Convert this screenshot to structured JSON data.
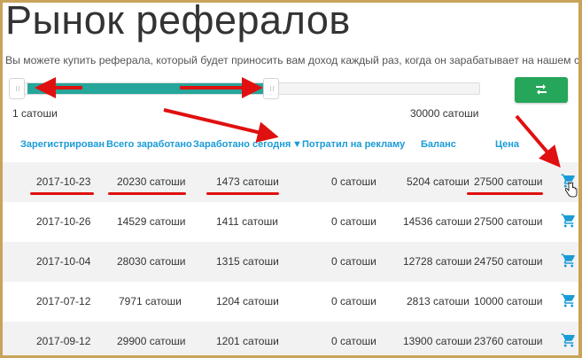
{
  "page": {
    "title": "Рынок рефералов",
    "description": "Вы можете купить реферала, который будет приносить вам доход каждый раз, когда он зарабатывает на нашем сайте."
  },
  "filter": {
    "range_min_label": "1 сатоши",
    "range_max_label": "30000 сатоши",
    "apply_icon": "swap-arrows-icon"
  },
  "table": {
    "headers": {
      "registered": "Зарегистрирован",
      "total_earned": "Всего заработано",
      "earned_today": "Заработано сегодня",
      "sort_indicator": "▼",
      "spent_on_ads": "Потратил на рекламу",
      "balance": "Баланс",
      "price": "Цена"
    },
    "rows": [
      {
        "registered": "2017-10-23",
        "total_earned": "20230 сатоши",
        "earned_today": "1473 сатоши",
        "spent_on_ads": "0 сатоши",
        "balance": "5204 сатоши",
        "price": "27500 сатоши"
      },
      {
        "registered": "2017-10-26",
        "total_earned": "14529 сатоши",
        "earned_today": "1411 сатоши",
        "spent_on_ads": "0 сатоши",
        "balance": "14536 сатоши",
        "price": "27500 сатоши"
      },
      {
        "registered": "2017-10-04",
        "total_earned": "28030 сатоши",
        "earned_today": "1315 сатоши",
        "spent_on_ads": "0 сатоши",
        "balance": "12728 сатоши",
        "price": "24750 сатоши"
      },
      {
        "registered": "2017-07-12",
        "total_earned": "7971 сатоши",
        "earned_today": "1204 сатоши",
        "spent_on_ads": "0 сатоши",
        "balance": "2813 сатоши",
        "price": "10000 сатоши"
      },
      {
        "registered": "2017-09-12",
        "total_earned": "29900 сатоши",
        "earned_today": "1201 сатоши",
        "spent_on_ads": "0 сатоши",
        "balance": "13900 сатоши",
        "price": "23760 сатоши"
      }
    ]
  },
  "colors": {
    "accent": "#26a69a",
    "button": "#26a65b",
    "header_text": "#1a9bd7",
    "annotation": "#e01010"
  }
}
